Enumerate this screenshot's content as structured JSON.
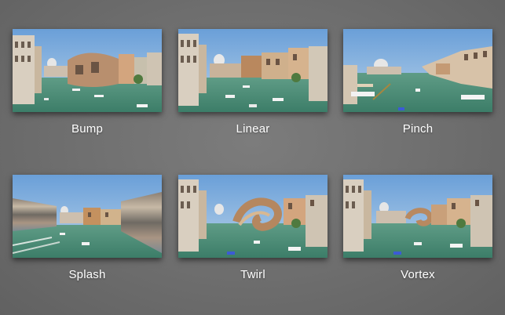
{
  "effects": [
    {
      "label": "Bump"
    },
    {
      "label": "Linear"
    },
    {
      "label": "Pinch"
    },
    {
      "label": "Splash"
    },
    {
      "label": "Twirl"
    },
    {
      "label": "Vortex"
    }
  ],
  "colors": {
    "background": "#6e6e6e",
    "label": "#ffffff",
    "sky": "#8fb8e0",
    "water": "#4d8f7a"
  }
}
